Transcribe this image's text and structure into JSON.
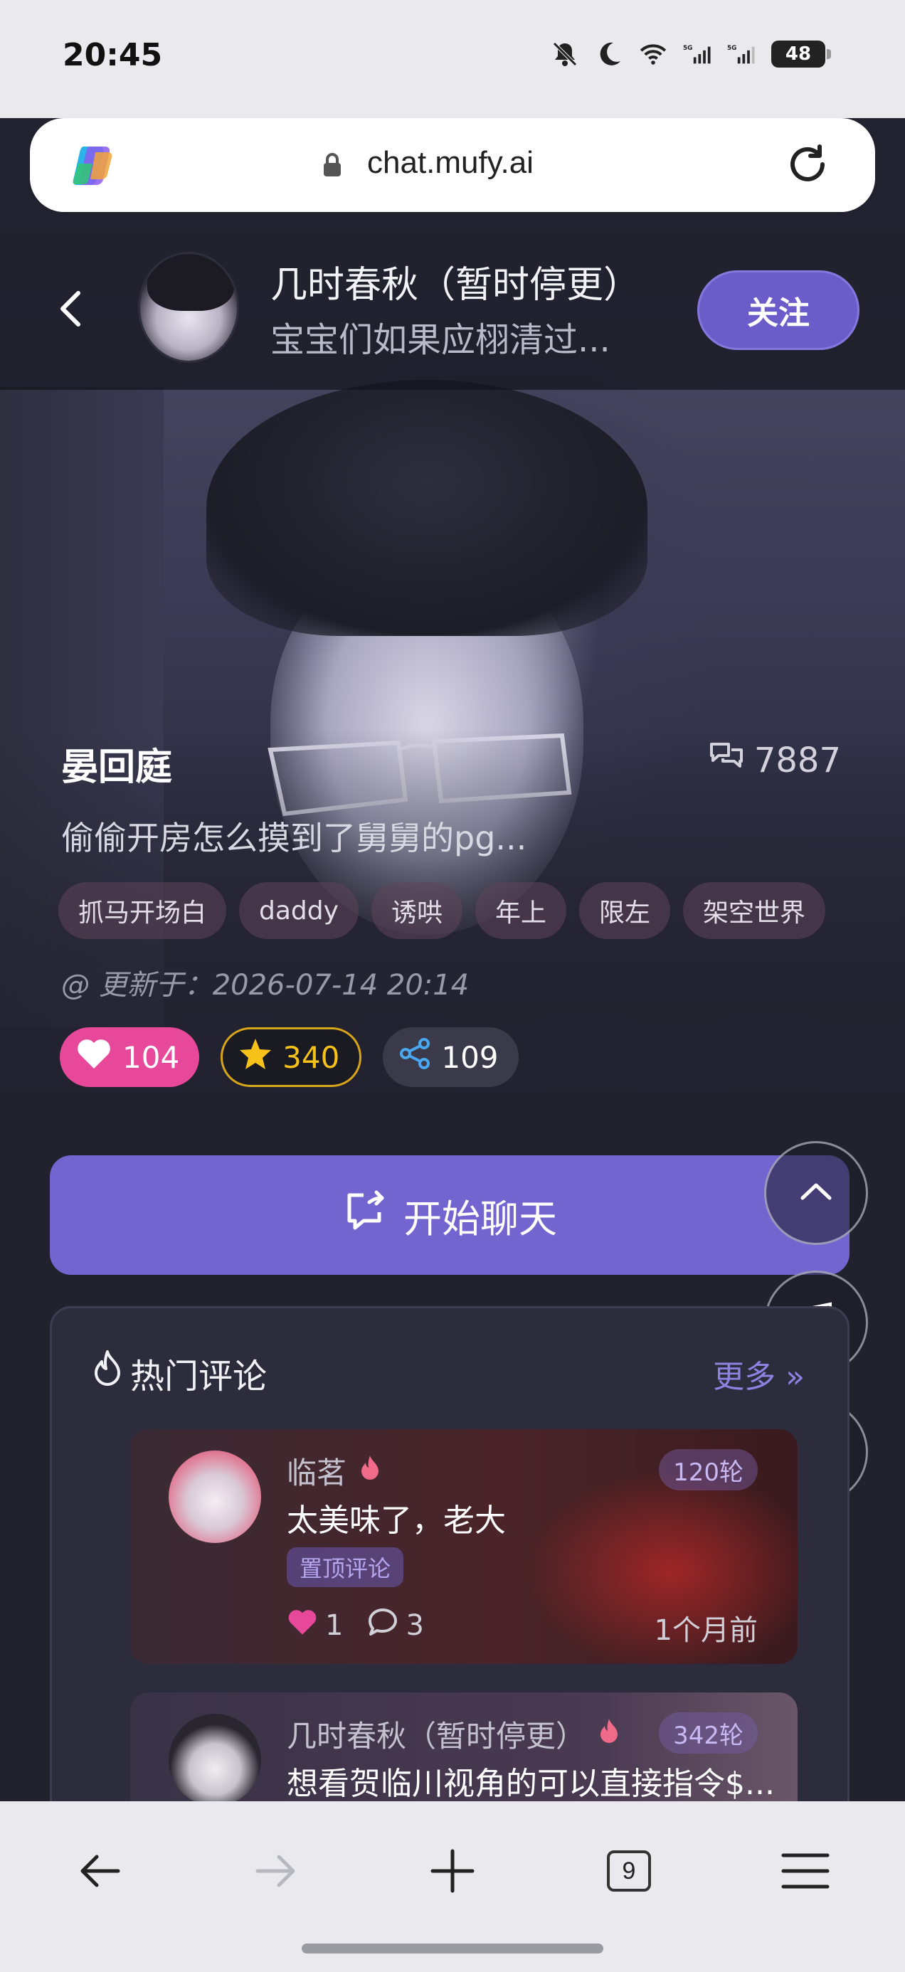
{
  "status_bar": {
    "time": "20:45",
    "battery": "48",
    "network_1": "5G",
    "network_2": "5G"
  },
  "browser": {
    "url": "chat.mufy.ai",
    "tab_count": "9"
  },
  "header": {
    "author_name": "几时春秋（暂时停更）",
    "author_subtitle": "宝宝们如果应栩清过...",
    "follow_label": "关注"
  },
  "character": {
    "name": "晏回庭",
    "chat_count": "7887",
    "description": "偷偷开房怎么摸到了舅舅的pg...",
    "tags": [
      "抓马开场白",
      "daddy",
      "诱哄",
      "年上",
      "限左",
      "架空世界"
    ],
    "updated": "@ 更新于：2026-07-14 20:14"
  },
  "stats": {
    "likes": "104",
    "stars": "340",
    "shares": "109"
  },
  "start_chat_label": "开始聊天",
  "comments": {
    "title": "热门评论",
    "more_label": "更多",
    "items": [
      {
        "user": "临茗",
        "rounds": "120轮",
        "text": "太美味了，老大",
        "badge": "置顶评论",
        "likes": "1",
        "replies": "3",
        "time": "1个月前"
      },
      {
        "user": "几时春秋（暂时停更）",
        "rounds": "342轮",
        "text": "想看贺临川视角的可以直接指令$..."
      }
    ]
  },
  "colors": {
    "accent": "#7365d0",
    "like": "#e8489a",
    "star": "#f6c21a",
    "background": "#22222f"
  }
}
